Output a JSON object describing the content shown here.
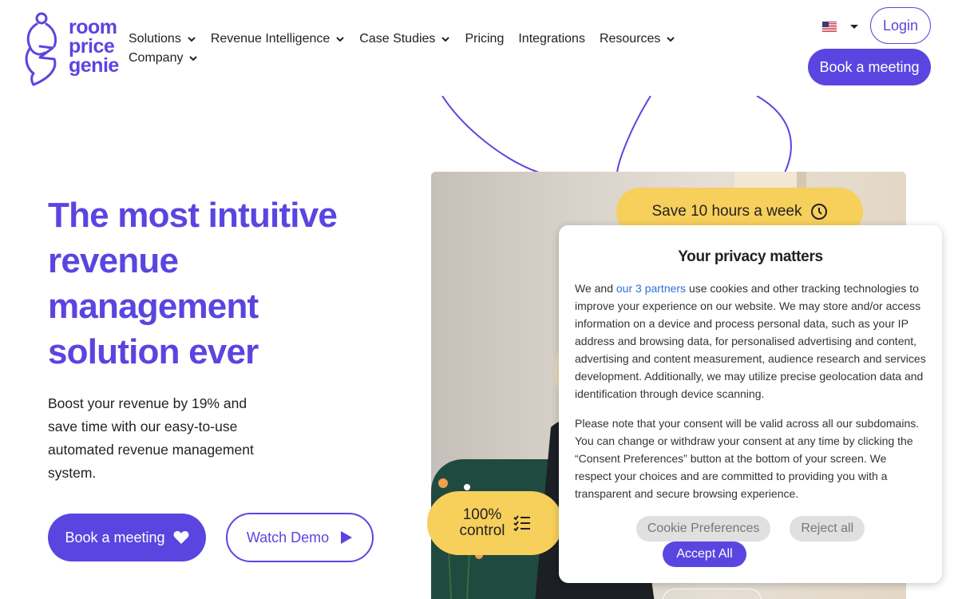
{
  "brand": {
    "logo_line1": "room",
    "logo_line2": "price",
    "logo_line3": "genie",
    "accent_color": "#5b45e0",
    "badge_color": "#f7cf5b"
  },
  "nav": {
    "items": [
      {
        "label": "Solutions",
        "has_dropdown": true
      },
      {
        "label": "Revenue Intelligence",
        "has_dropdown": true
      },
      {
        "label": "Case Studies",
        "has_dropdown": true
      },
      {
        "label": "Pricing",
        "has_dropdown": false
      },
      {
        "label": "Integrations",
        "has_dropdown": false
      },
      {
        "label": "Resources",
        "has_dropdown": true
      },
      {
        "label": "Company",
        "has_dropdown": true
      }
    ],
    "language_icon": "us-flag-icon",
    "login_label": "Login",
    "book_label": "Book a meeting"
  },
  "hero": {
    "title_lines": [
      "The most intuitive",
      "revenue",
      "management",
      "solution ever"
    ],
    "subtitle": "Boost your revenue by 19% and save time with our easy-to-use automated revenue management system.",
    "book_button": "Book a meeting",
    "demo_button": "Watch Demo"
  },
  "badges": {
    "save_text": "Save 10 hours a week",
    "control_line1": "100%",
    "control_line2": "control"
  },
  "privacy": {
    "title": "Your privacy matters",
    "p1_prefix": "We and ",
    "p1_link": "our 3 partners",
    "p1_rest": " use cookies and other tracking technologies to improve your experience on our website. We may store and/or access information on a device and process personal data, such as your IP address and browsing data, for personalised advertising and content, advertising and content measurement, audience research and services development. Additionally, we may utilize precise geolocation data and identification through device scanning.",
    "p2": "Please note that your consent will be valid across all our subdomains. You can change or withdraw your consent at any time by clicking the “Consent Preferences” button at the bottom of your screen. We respect your choices and are committed to providing you with a transparent and secure browsing experience.",
    "preferences_label": "Cookie Preferences",
    "reject_label": "Reject all",
    "accept_label": "Accept All"
  }
}
